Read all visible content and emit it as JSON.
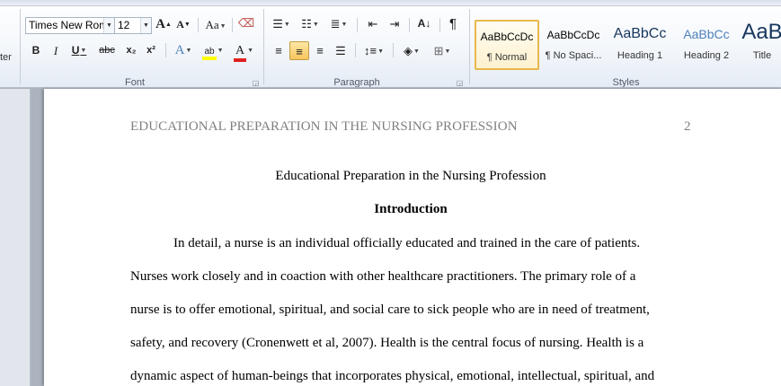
{
  "ribbon": {
    "partial_left_label": "ter",
    "font": {
      "name": "Times New Rom",
      "size": "12",
      "grow_label": "A",
      "shrink_label": "A",
      "case_label": "Aa",
      "bold_label": "B",
      "italic_label": "I",
      "underline_label": "U",
      "strike_label": "abc",
      "subscript_label": "x₂",
      "superscript_label": "x²",
      "effects_label": "A",
      "highlight_label": "ab",
      "color_label": "A",
      "group_label": "Font"
    },
    "paragraph": {
      "group_label": "Paragraph",
      "pilcrow_label": "¶"
    },
    "styles": {
      "group_label": "Styles",
      "items": [
        {
          "sample": "AaBbCcDc",
          "name": "¶ Normal"
        },
        {
          "sample": "AaBbCcDc",
          "name": "¶ No Spaci..."
        },
        {
          "sample": "AaBbCc",
          "name": "Heading 1"
        },
        {
          "sample": "AaBbCc",
          "name": "Heading 2"
        },
        {
          "sample": "AaB",
          "name": "Title"
        }
      ]
    },
    "colors": {
      "heading_blue": "#17365D",
      "heading2_blue": "#4F81BD",
      "font_red": "#E02020",
      "highlight_yellow": "#FFFF00"
    }
  },
  "document": {
    "header": "EDUCATIONAL PREPARATION IN THE NURSING PROFESSION",
    "page_number": "2",
    "title": "Educational Preparation in the Nursing Profession",
    "heading": "Introduction",
    "lines": [
      "In detail, a nurse is an individual officially educated and trained in the care of patients.",
      "Nurses work closely and in coaction with other healthcare practitioners. The primary role of a",
      "nurse is to offer emotional, spiritual, and social care to sick people who are in need of treatment,",
      "safety, and recovery (Cronenwett et al, 2007). Health is the central focus of nursing. Health is a",
      "dynamic aspect of human-beings that incorporates physical, emotional, intellectual, spiritual, and"
    ]
  }
}
